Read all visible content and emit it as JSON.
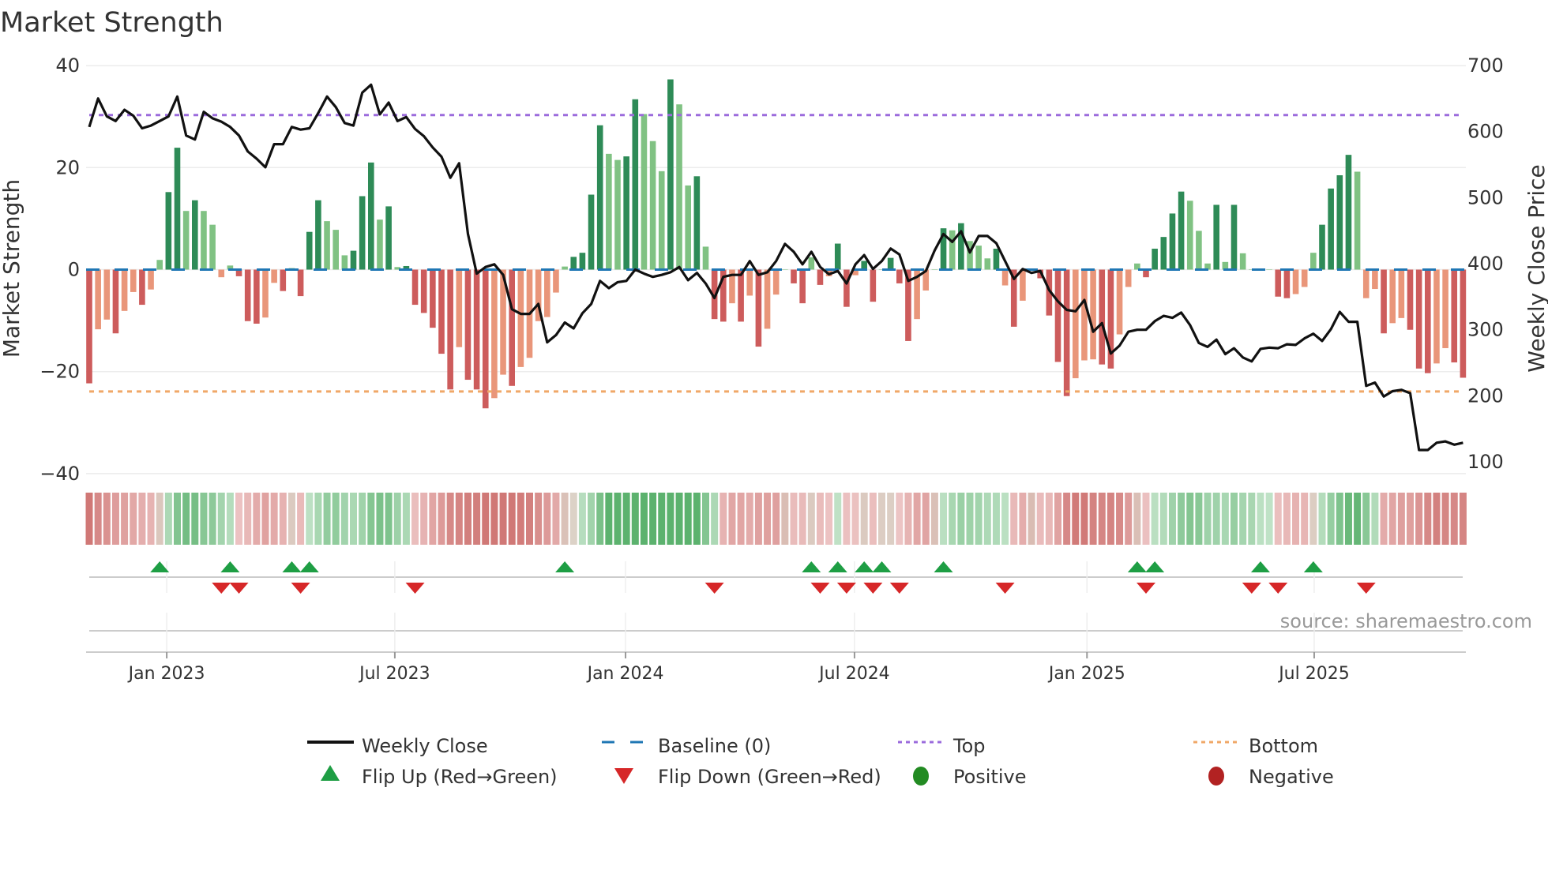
{
  "chart_data": {
    "type": "bar",
    "title": "Market Strength",
    "ylabel": "Market Strength",
    "y2label": "Weekly Close Price",
    "ylim": [
      -40,
      40
    ],
    "y2lim": [
      100,
      700
    ],
    "yticks": [
      "40",
      "20",
      "0",
      "−20",
      "−40"
    ],
    "ytick_values": [
      40,
      20,
      0,
      -20,
      -40
    ],
    "y2ticks": [
      "700",
      "600",
      "500",
      "400",
      "300",
      "200",
      "100"
    ],
    "y2tick_values": [
      700,
      600,
      500,
      400,
      300,
      200,
      100
    ],
    "x_unit": "week index",
    "xticks": [
      {
        "label": "Jan 2023",
        "week": 8.8
      },
      {
        "label": "Jul 2023",
        "week": 34.7
      },
      {
        "label": "Jan 2024",
        "week": 60.9
      },
      {
        "label": "Jul 2024",
        "week": 86.9
      },
      {
        "label": "Jan 2025",
        "week": 113.3
      },
      {
        "label": "Jul 2025",
        "week": 139.1
      }
    ],
    "grid": true,
    "top_level": 30.3,
    "bottom_level": -23.9,
    "baseline": 0,
    "strength": [
      -22.3,
      -11.7,
      -9.8,
      -12.5,
      -8.1,
      -4.4,
      -6.9,
      -3.9,
      1.9,
      15.2,
      23.9,
      11.5,
      13.6,
      11.5,
      8.8,
      -1.5,
      0.8,
      -1.3,
      -10.1,
      -10.6,
      -9.4,
      -2.6,
      -4.2,
      0.3,
      -5.2,
      7.4,
      13.6,
      9.5,
      7.8,
      2.8,
      3.7,
      14.4,
      21.0,
      9.8,
      12.4,
      0.5,
      0.7,
      -6.9,
      -8.5,
      -11.4,
      -16.5,
      -23.5,
      -15.2,
      -21.6,
      -23.5,
      -27.2,
      -25.2,
      -20.6,
      -22.8,
      -19.1,
      -17.3,
      -10.1,
      -9.3,
      -4.5,
      0.6,
      2.5,
      3.3,
      14.7,
      28.3,
      22.7,
      21.5,
      22.2,
      33.4,
      30.5,
      25.2,
      19.3,
      37.3,
      32.4,
      16.5,
      18.3,
      4.5,
      -9.7,
      -10.2,
      -6.6,
      -10.2,
      -5.1,
      -15.1,
      -11.6,
      -4.9,
      0,
      -2.7,
      -6.6,
      2.4,
      -3.0,
      -1.3,
      5.1,
      -7.3,
      -1.1,
      1.7,
      -6.3,
      0,
      2.3,
      -2.7,
      -14.0,
      -9.7,
      -4.1,
      0,
      8.1,
      7.7,
      9.1,
      5.6,
      4.7,
      2.2,
      4.1,
      -3.1,
      -11.2,
      -6.1,
      0,
      -1.7,
      -9.0,
      -18.1,
      -24.8,
      -21.3,
      -17.8,
      -17.6,
      -18.6,
      -19.4,
      -12.7,
      -3.4,
      1.2,
      -1.5,
      4.1,
      6.4,
      11.0,
      15.3,
      13.5,
      7.6,
      1.2,
      12.7,
      1.5,
      12.7,
      3.2,
      0,
      0.2,
      0,
      -5.3,
      -5.6,
      -4.8,
      -3.4,
      3.3,
      8.8,
      15.9,
      18.5,
      22.5,
      19.2,
      -5.6,
      -3.8,
      -12.5,
      -10.5,
      -9.5,
      -11.8,
      -19.4,
      -20.3,
      -18.4,
      -15.4,
      -18.2,
      -21.2
    ],
    "weekly_close": [
      607,
      650,
      623,
      616,
      633,
      624,
      605,
      609,
      616,
      623,
      653,
      594,
      588,
      630,
      620,
      615,
      607,
      594,
      570,
      559,
      546,
      581,
      581,
      607,
      603,
      605,
      628,
      653,
      637,
      613,
      609,
      659,
      671,
      626,
      644,
      616,
      622,
      604,
      593,
      576,
      562,
      530,
      552,
      445,
      385,
      395,
      399,
      383,
      331,
      324,
      324,
      339,
      281,
      292,
      311,
      302,
      325,
      339,
      374,
      363,
      372,
      374,
      391,
      385,
      380,
      383,
      387,
      395,
      375,
      386,
      370,
      348,
      380,
      383,
      383,
      404,
      383,
      387,
      404,
      430,
      418,
      399,
      418,
      395,
      384,
      389,
      370,
      399,
      413,
      392,
      404,
      423,
      414,
      374,
      380,
      389,
      420,
      445,
      433,
      449,
      417,
      442,
      442,
      431,
      404,
      377,
      392,
      386,
      389,
      360,
      343,
      330,
      328,
      345,
      297,
      310,
      264,
      276,
      297,
      300,
      300,
      313,
      321,
      318,
      326,
      307,
      280,
      274,
      285,
      263,
      272,
      258,
      252,
      271,
      273,
      272,
      278,
      277,
      287,
      294,
      283,
      301,
      327,
      312,
      312,
      215,
      220,
      199,
      207,
      209,
      204,
      118,
      118,
      129,
      131,
      126,
      129
    ],
    "flip_up_weeks": [
      8,
      16,
      23,
      25,
      54,
      82,
      85,
      88,
      90,
      97,
      119,
      121,
      133,
      139
    ],
    "flip_down_weeks": [
      15,
      17,
      24,
      37,
      71,
      83,
      86,
      89,
      92,
      104,
      120,
      132,
      135,
      145
    ],
    "legend": {
      "weekly_close": "Weekly Close",
      "baseline": "Baseline (0)",
      "top": "Top",
      "bottom": "Bottom",
      "flip_up": "Flip Up (Red→Green)",
      "flip_down": "Flip Down (Green→Red)",
      "positive": "Positive",
      "negative": "Negative"
    },
    "legend_placement": "bottom",
    "source": "source: sharemaestro.com",
    "colors": {
      "pos_rising": "#2e8b57",
      "pos_falling": "#80c283",
      "neg_falling": "#cd5c5c",
      "neg_rising": "#e9967a",
      "close": "#111111",
      "baseline": "#1f77b4",
      "top": "#9b6bdc",
      "bottom": "#f0a868",
      "flip_up": "#1e9e44",
      "flip_down": "#d62728",
      "positive": "#228b22",
      "negative": "#b22222"
    }
  }
}
